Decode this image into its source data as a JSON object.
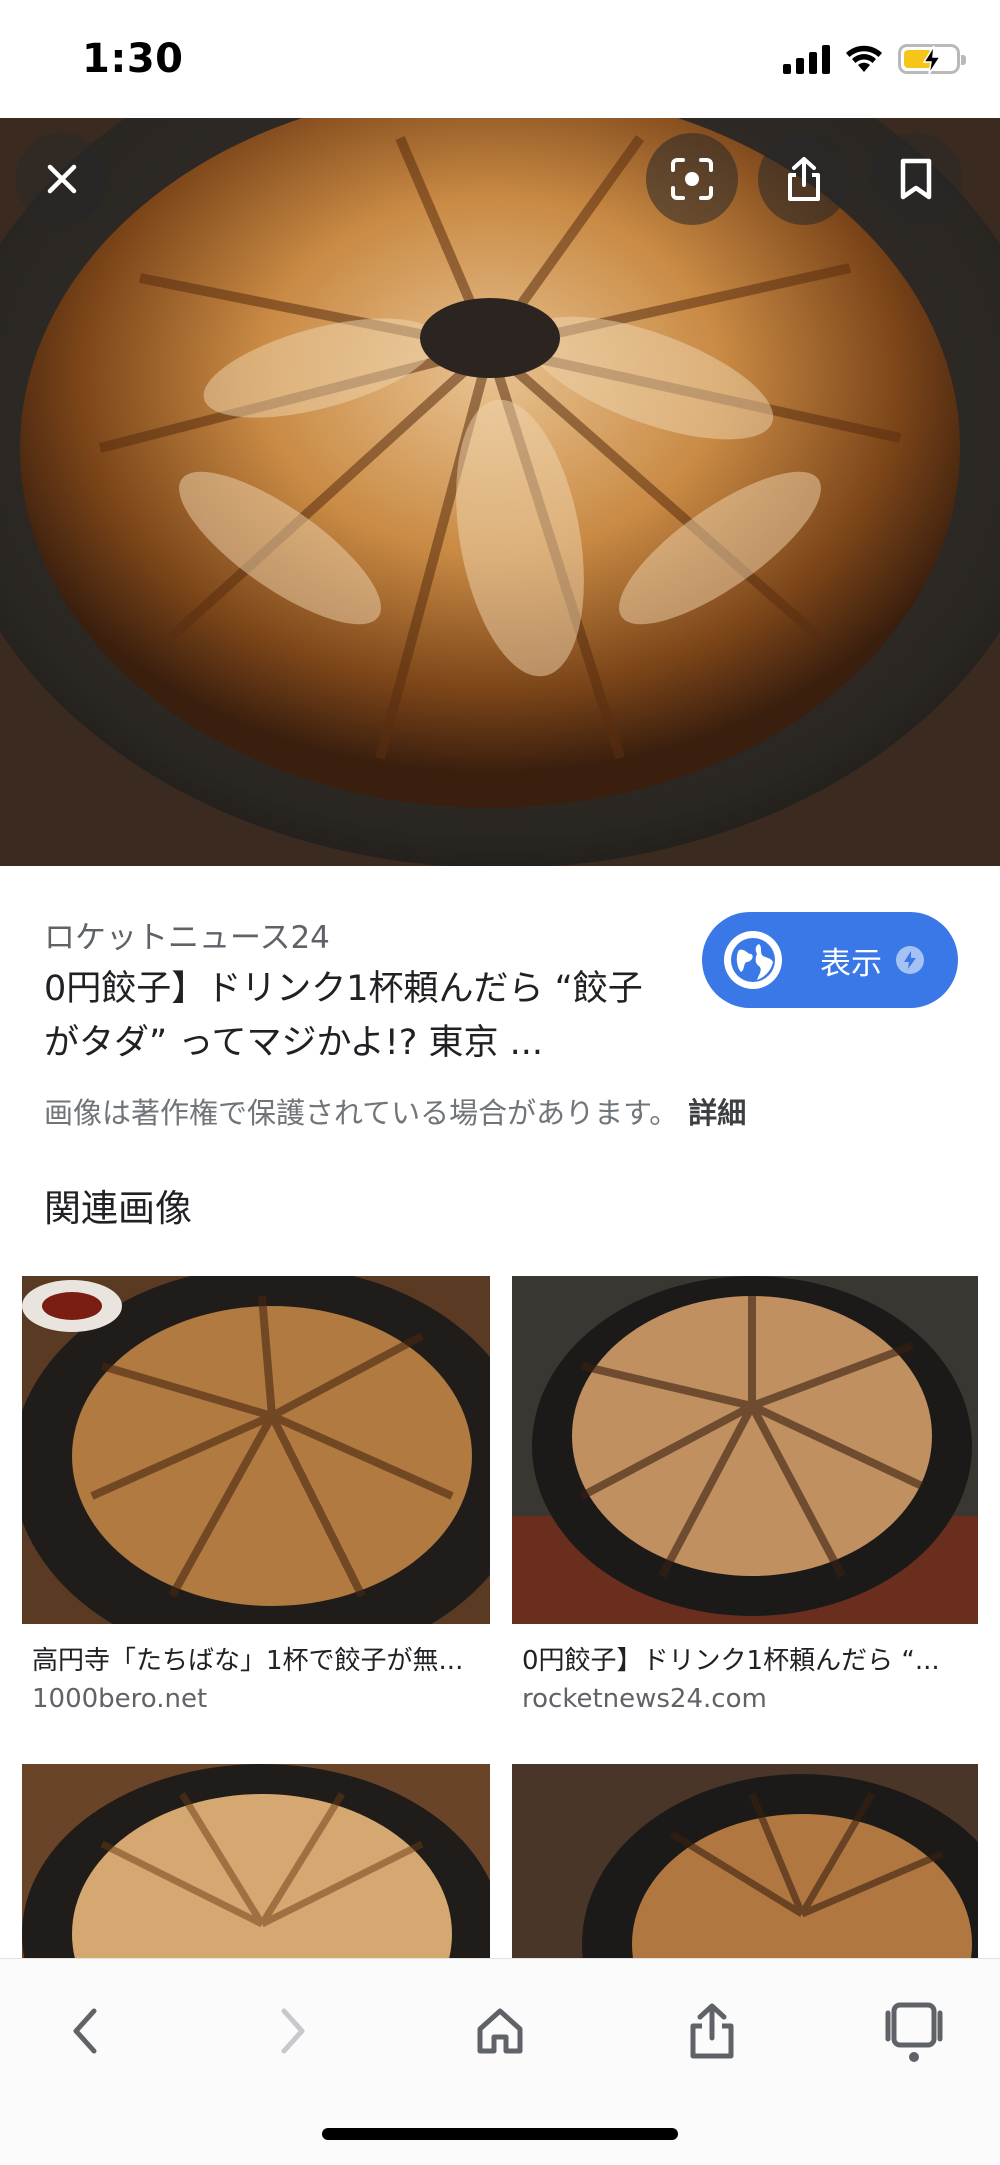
{
  "status_bar": {
    "time": "1:30"
  },
  "source_name": "ロケットニュース24",
  "result_title": "0円餃子】ドリンク1杯頼んだら “餃子がタダ” ってマジかよ!? 東京 ...",
  "visit_label": "表示",
  "copyright_notice": "画像は著作権で保護されている場合があります。",
  "details_link": "詳細",
  "related_heading": "関連画像",
  "related_images": [
    {
      "caption": "高円寺「たちばな」1杯で餃子が無...",
      "domain": "1000bero.net"
    },
    {
      "caption": "0円餃子】ドリンク1杯頼んだら “...",
      "domain": "rocketnews24.com"
    }
  ],
  "icons": {
    "close": "close-icon",
    "lens": "lens-icon",
    "share": "share-icon",
    "bookmark": "bookmark-icon",
    "globe": "globe-icon",
    "amp": "amp-bolt-icon",
    "back": "chevron-left-icon",
    "forward": "chevron-right-icon",
    "home": "home-icon",
    "tabs": "tabs-icon"
  },
  "colors": {
    "accent": "#3a78e7",
    "text": "#202124",
    "muted": "#5f6368"
  }
}
